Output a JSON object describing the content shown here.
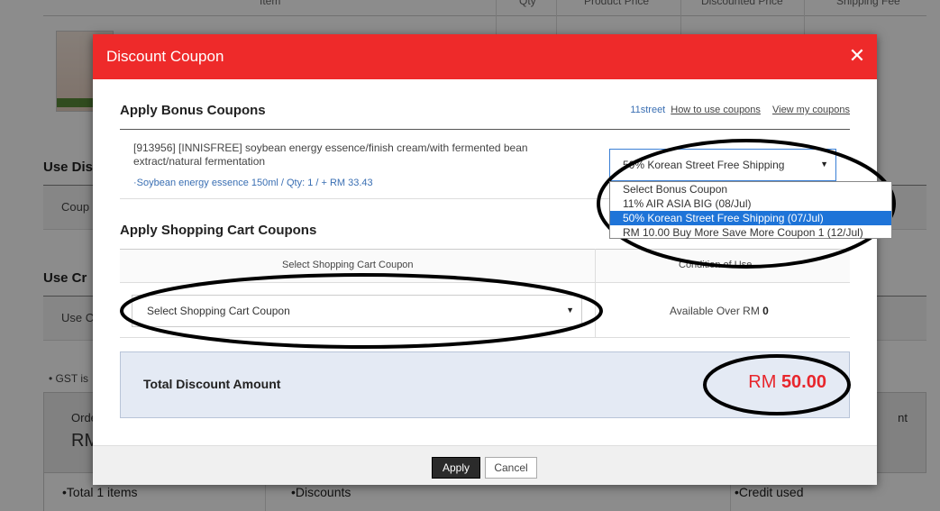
{
  "background": {
    "table_head": {
      "item": "Item",
      "qty": "Qty",
      "product_price": "Product Price",
      "discounted_price": "Discounted Price",
      "shipping_fee": "Shipping Fee"
    },
    "use_discount_title": "Use Dis",
    "coupon_row": "Coup",
    "use_credit_title": "Use Cr",
    "use_credit_row": "Use C",
    "gst_note": "• GST is",
    "order_label": "Orde",
    "order_amount": "RM",
    "order_right": "nt",
    "total_items": "•Total 1 items",
    "discounts": "•Discounts",
    "credit_used": "•Credit used"
  },
  "modal": {
    "title": "Discount Coupon",
    "close_glyph": "✕",
    "bonus": {
      "title": "Apply Bonus Coupons",
      "brand_link": "11street",
      "how_to_link": "How to use coupons",
      "view_link": "View my coupons",
      "product_name": "[913956] [INNISFREE] soybean energy essence/finish cream/with fermented bean extract/natural fermentation",
      "product_option": "·Soybean energy essence 150ml / Qty: 1 / + RM 33.43",
      "selected": "50% Korean Street Free Shipping",
      "options": [
        "Select Bonus Coupon",
        "11% AIR ASIA BIG (08/Jul)",
        "50% Korean Street Free Shipping (07/Jul)",
        "RM 10.00 Buy More Save More Coupon 1 (12/Jul)"
      ]
    },
    "cart": {
      "title": "Apply Shopping Cart Coupons",
      "col_select": "Select Shopping Cart Coupon",
      "col_condition": "Condition of Use",
      "select_value": "Select Shopping Cart Coupon",
      "available_prefix": "Available Over RM",
      "available_value": "0"
    },
    "total": {
      "label": "Total Discount Amount",
      "currency": "RM",
      "amount": "50.00"
    },
    "buttons": {
      "apply": "Apply",
      "cancel": "Cancel"
    }
  },
  "colors": {
    "header_red": "#ee2a2a",
    "link_blue": "#3a6fb3",
    "selected_blue": "#1e74d8",
    "total_red": "#e8262c"
  }
}
